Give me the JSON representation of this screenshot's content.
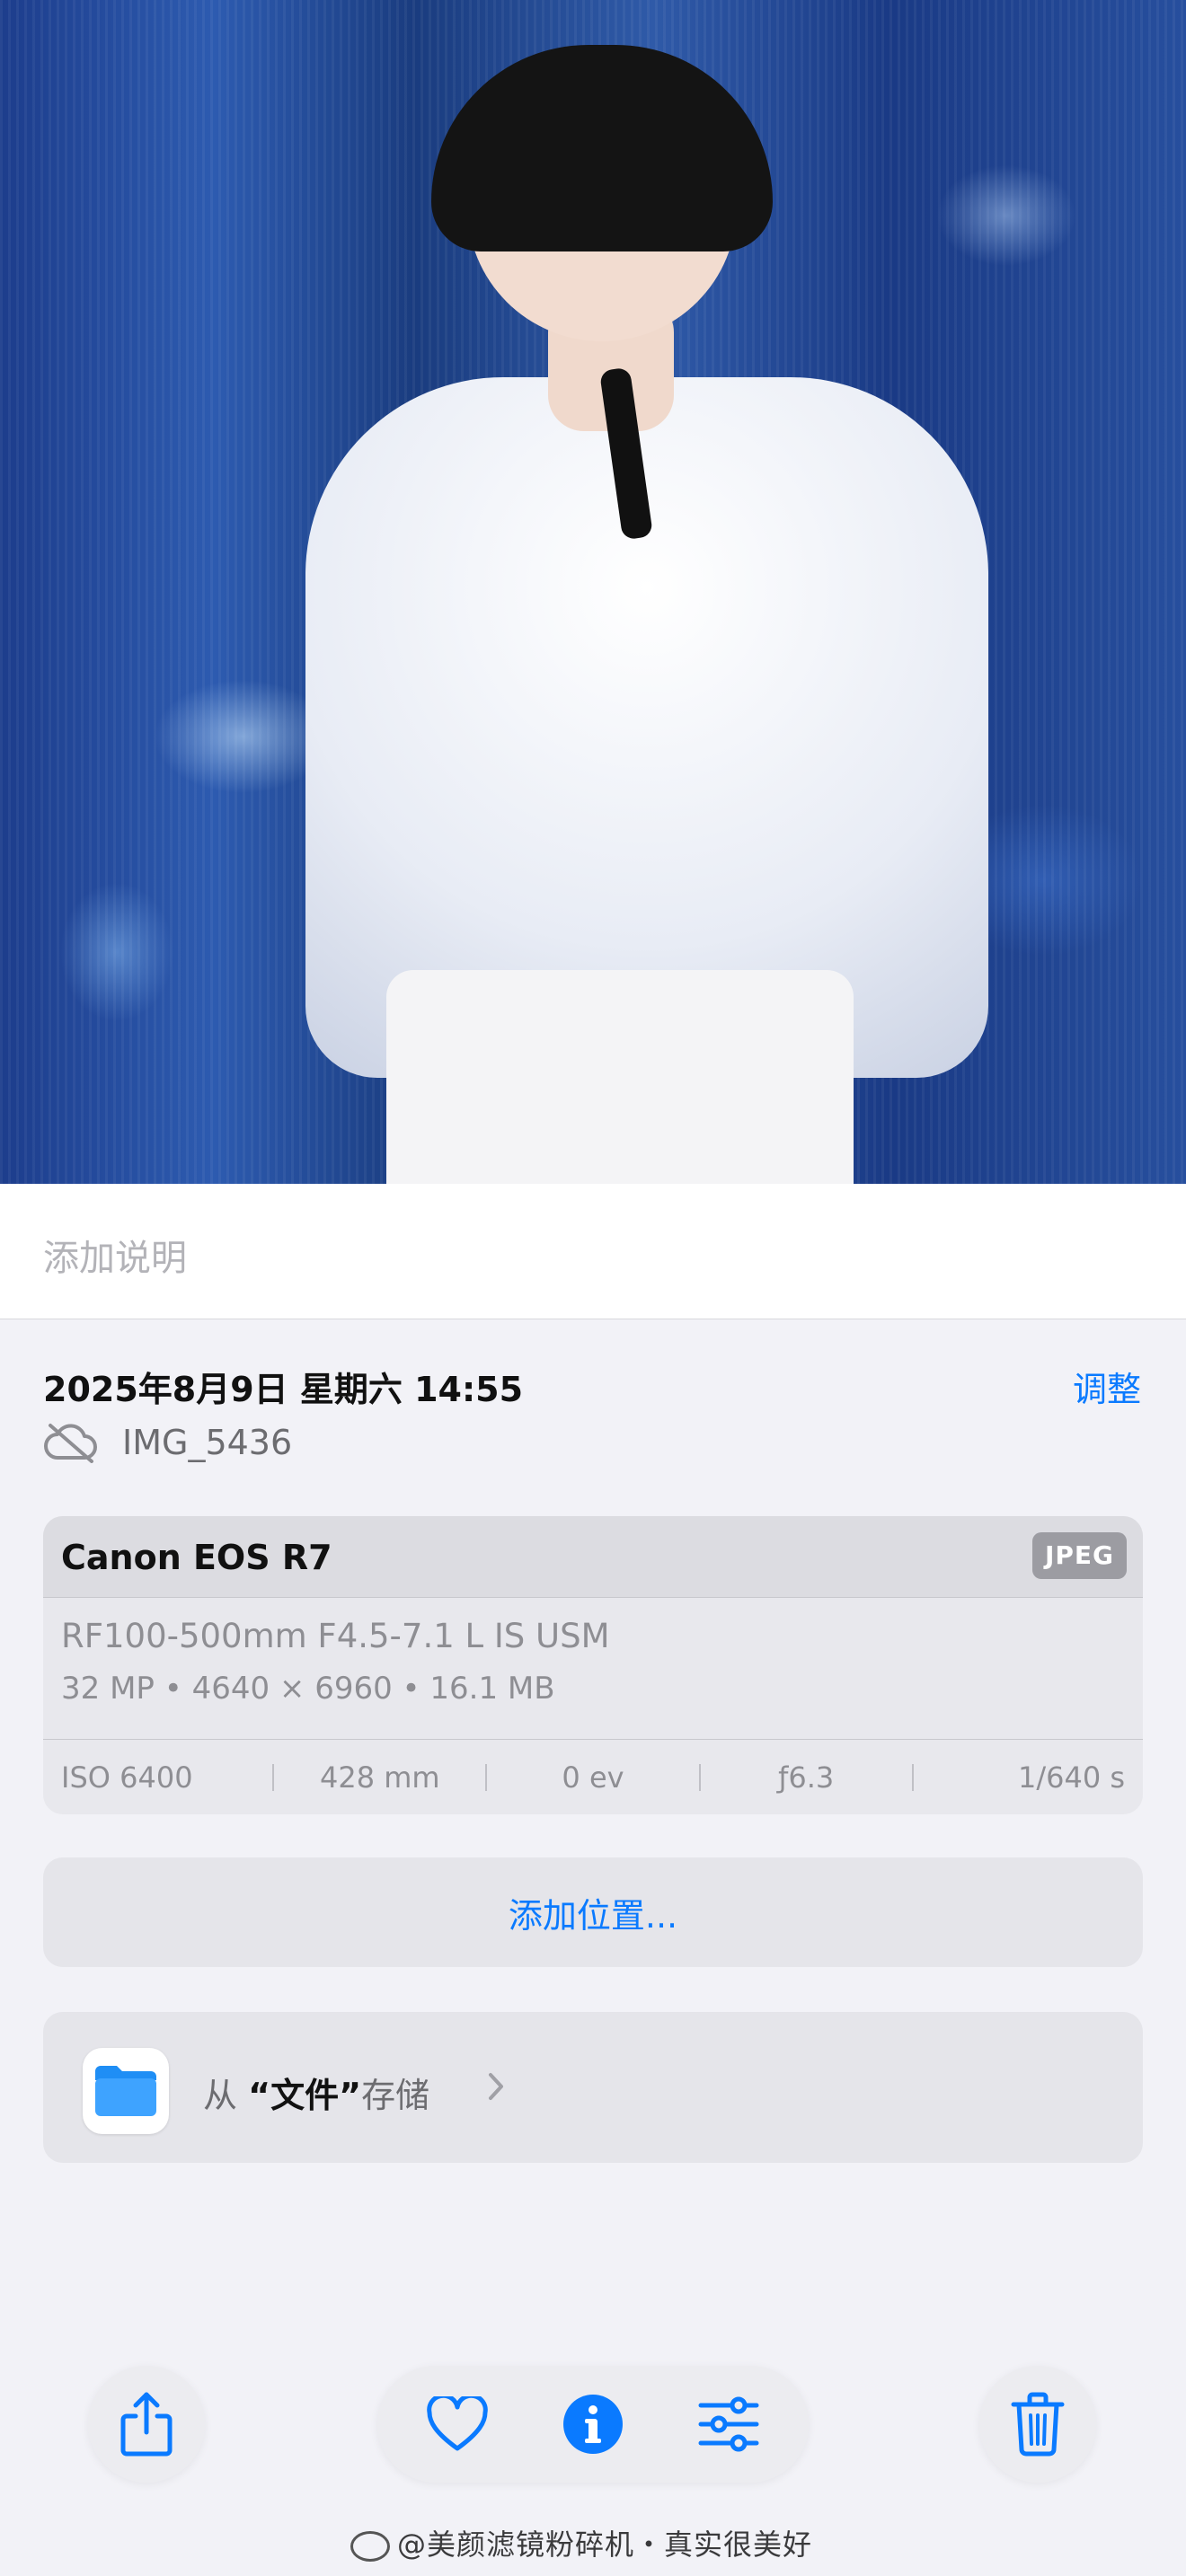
{
  "caption": {
    "placeholder": "添加说明"
  },
  "meta": {
    "datetime": "2025年8月9日 星期六 14:55",
    "adjust_label": "调整",
    "filename": "IMG_5436",
    "cloud_icon": "cloud-slash-icon"
  },
  "exif": {
    "camera": "Canon EOS R7",
    "format": "JPEG",
    "lens": "RF100-500mm F4.5-7.1 L IS USM",
    "specs": "32 MP • 4640 × 6960 • 16.1 MB",
    "iso": "ISO 6400",
    "focal_length": "428 mm",
    "exposure": "0 ev",
    "aperture": "ƒ6.3",
    "shutter": "1/640 s"
  },
  "location": {
    "label": "添加位置..."
  },
  "files": {
    "prefix": "从",
    "app_name": "“文件”",
    "suffix": "存储"
  },
  "toolbar": {
    "share": "share-icon",
    "favorite": "heart-icon",
    "info": "info-icon",
    "edit": "sliders-icon",
    "delete": "trash-icon"
  },
  "watermark": {
    "text": "@美颜滤镜粉碎机・真实很美好"
  },
  "colors": {
    "accent": "#0a7aff",
    "background": "#f2f2f7"
  }
}
